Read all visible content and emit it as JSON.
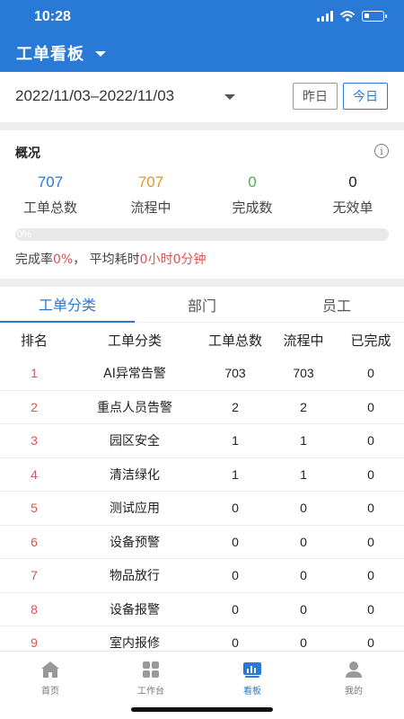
{
  "status_bar": {
    "time": "10:28"
  },
  "header": {
    "title": "工单看板"
  },
  "date_filter": {
    "range": "2022/11/03–2022/11/03",
    "yesterday_label": "昨日",
    "today_label": "今日"
  },
  "overview": {
    "title": "概况",
    "info_icon": "i",
    "stats": [
      {
        "value": "707",
        "label": "工单总数",
        "color": "#2979d6"
      },
      {
        "value": "707",
        "label": "流程中",
        "color": "#e0962b"
      },
      {
        "value": "0",
        "label": "完成数",
        "color": "#4caf50"
      },
      {
        "value": "0",
        "label": "无效单",
        "color": "#222222"
      }
    ],
    "progress": {
      "percent": 0,
      "label": "0%"
    },
    "summary": {
      "completion_label": "完成率",
      "completion_value": "0%",
      "separator": "，",
      "avg_label": "平均耗时",
      "avg_value": "0小时0分钟"
    }
  },
  "tabs": [
    {
      "label": "工单分类",
      "active": true
    },
    {
      "label": "部门",
      "active": false
    },
    {
      "label": "员工",
      "active": false
    }
  ],
  "table": {
    "headers": {
      "rank": "排名",
      "category": "工单分类",
      "total": "工单总数",
      "in_progress": "流程中",
      "done": "已完成"
    },
    "rows": [
      {
        "rank": "1",
        "category": "AI异常告警",
        "total": "703",
        "in_progress": "703",
        "done": "0"
      },
      {
        "rank": "2",
        "category": "重点人员告警",
        "total": "2",
        "in_progress": "2",
        "done": "0"
      },
      {
        "rank": "3",
        "category": "园区安全",
        "total": "1",
        "in_progress": "1",
        "done": "0"
      },
      {
        "rank": "4",
        "category": "清洁绿化",
        "total": "1",
        "in_progress": "1",
        "done": "0"
      },
      {
        "rank": "5",
        "category": "测试应用",
        "total": "0",
        "in_progress": "0",
        "done": "0"
      },
      {
        "rank": "6",
        "category": "设备预警",
        "total": "0",
        "in_progress": "0",
        "done": "0"
      },
      {
        "rank": "7",
        "category": "物品放行",
        "total": "0",
        "in_progress": "0",
        "done": "0"
      },
      {
        "rank": "8",
        "category": "设备报警",
        "total": "0",
        "in_progress": "0",
        "done": "0"
      },
      {
        "rank": "9",
        "category": "室内报修",
        "total": "0",
        "in_progress": "0",
        "done": "0"
      }
    ]
  },
  "bottom_nav": [
    {
      "label": "首页",
      "icon": "home-icon",
      "active": false
    },
    {
      "label": "工作台",
      "icon": "grid-icon",
      "active": false
    },
    {
      "label": "看板",
      "icon": "chart-icon",
      "active": true
    },
    {
      "label": "我的",
      "icon": "user-icon",
      "active": false
    }
  ],
  "colors": {
    "primary": "#2979d6",
    "red": "#d9534f",
    "orange": "#e0962b",
    "green": "#4caf50"
  }
}
